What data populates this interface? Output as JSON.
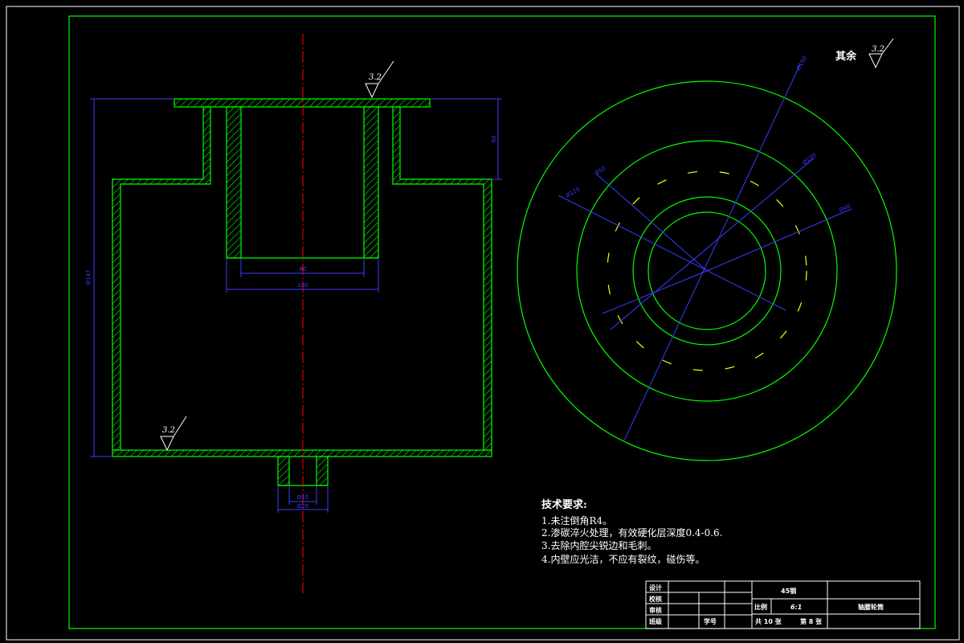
{
  "colors": {
    "background": "#000000",
    "outline": "#00ff00",
    "hatch": "#00ff00",
    "centerline": "#ff0000",
    "dimension": "#3b3bff",
    "dashed_circle": "#ffff00",
    "text": "#ffffff"
  },
  "roughness": {
    "general_label": "其余",
    "general_value": "3.2",
    "top_value": "3.2",
    "bottom_value": "3.2"
  },
  "dimensions": {
    "height_total": "Ø147",
    "upper_step": "60",
    "bore_inner": "80",
    "bore_outer": "100",
    "shaft_inner": "Ø15",
    "shaft_outer": "Ø20",
    "circle_1": "Ø50",
    "circle_2": "Ø40",
    "circle_3": "Ø100",
    "circle_4": "Ø120",
    "circle_5": "Ø150"
  },
  "tech_requirements": {
    "title": "技术要求:",
    "items": [
      "1.未注倒角R4。",
      "2.渗碳淬火处理，有效硬化层深度0.4-0.6.",
      "3.去除内腔尖锐边和毛刺。",
      "4.内壁应光洁，不应有裂纹，碰伤等。"
    ]
  },
  "title_block": {
    "design": "设计",
    "check": "校核",
    "review": "审核",
    "class": "班级",
    "student_id": "学号",
    "material": "45钢",
    "scale_label": "比例",
    "scale_value": "6:1",
    "part_name": "轴腰轮筒",
    "total_sheets": "共 10 张",
    "sheet_no": "第 8 张"
  }
}
